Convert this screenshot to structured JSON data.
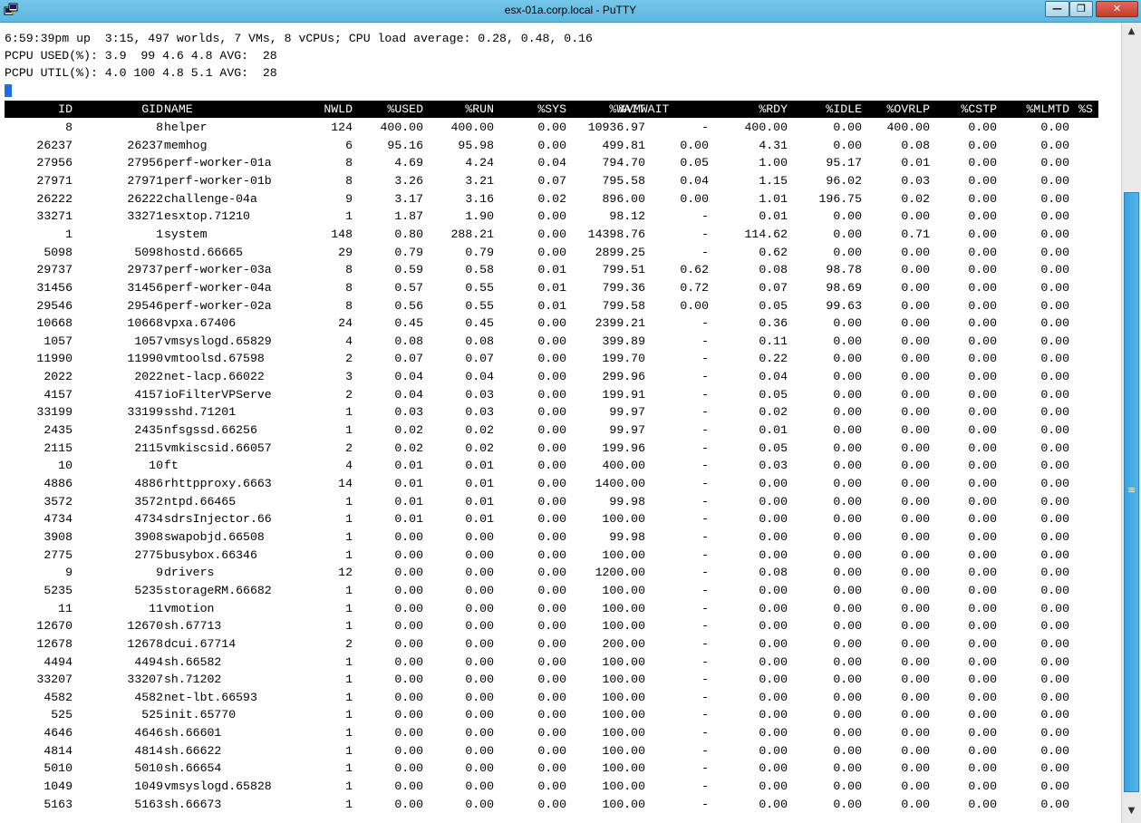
{
  "window": {
    "title": "esx-01a.corp.local - PuTTY",
    "icon": "putty-terminal-icon",
    "buttons": {
      "minimize": "—",
      "maximize": "❐",
      "close": "✕"
    }
  },
  "summary": {
    "uptime_line": "6:59:39pm up  3:15, 497 worlds, 7 VMs, 8 vCPUs; CPU load average: 0.28, 0.48, 0.16",
    "pcpu_used_line": "PCPU USED(%): 3.9  99 4.6 4.8 AVG:  28",
    "pcpu_util_line": "PCPU UTIL(%): 4.0 100 4.8 5.1 AVG:  28"
  },
  "table": {
    "headers": [
      "ID",
      "GID",
      "NAME",
      "NWLD",
      "%USED",
      "%RUN",
      "%SYS",
      "%WAIT",
      "%VMWAIT",
      "%RDY",
      "%IDLE",
      "%OVRLP",
      "%CSTP",
      "%MLMTD",
      "%S"
    ],
    "rows": [
      [
        "8",
        "8",
        "helper",
        "124",
        "400.00",
        "400.00",
        "0.00",
        "10936.97",
        "-",
        "400.00",
        "0.00",
        "400.00",
        "0.00",
        "0.00"
      ],
      [
        "26237",
        "26237",
        "memhog",
        "6",
        "95.16",
        "95.98",
        "0.00",
        "499.81",
        "0.00",
        "4.31",
        "0.00",
        "0.08",
        "0.00",
        "0.00"
      ],
      [
        "27956",
        "27956",
        "perf-worker-01a",
        "8",
        "4.69",
        "4.24",
        "0.04",
        "794.70",
        "0.05",
        "1.00",
        "95.17",
        "0.01",
        "0.00",
        "0.00"
      ],
      [
        "27971",
        "27971",
        "perf-worker-01b",
        "8",
        "3.26",
        "3.21",
        "0.07",
        "795.58",
        "0.04",
        "1.15",
        "96.02",
        "0.03",
        "0.00",
        "0.00"
      ],
      [
        "26222",
        "26222",
        "challenge-04a",
        "9",
        "3.17",
        "3.16",
        "0.02",
        "896.00",
        "0.00",
        "1.01",
        "196.75",
        "0.02",
        "0.00",
        "0.00"
      ],
      [
        "33271",
        "33271",
        "esxtop.71210",
        "1",
        "1.87",
        "1.90",
        "0.00",
        "98.12",
        "-",
        "0.01",
        "0.00",
        "0.00",
        "0.00",
        "0.00"
      ],
      [
        "1",
        "1",
        "system",
        "148",
        "0.80",
        "288.21",
        "0.00",
        "14398.76",
        "-",
        "114.62",
        "0.00",
        "0.71",
        "0.00",
        "0.00"
      ],
      [
        "5098",
        "5098",
        "hostd.66665",
        "29",
        "0.79",
        "0.79",
        "0.00",
        "2899.25",
        "-",
        "0.62",
        "0.00",
        "0.00",
        "0.00",
        "0.00"
      ],
      [
        "29737",
        "29737",
        "perf-worker-03a",
        "8",
        "0.59",
        "0.58",
        "0.01",
        "799.51",
        "0.62",
        "0.08",
        "98.78",
        "0.00",
        "0.00",
        "0.00"
      ],
      [
        "31456",
        "31456",
        "perf-worker-04a",
        "8",
        "0.57",
        "0.55",
        "0.01",
        "799.36",
        "0.72",
        "0.07",
        "98.69",
        "0.00",
        "0.00",
        "0.00"
      ],
      [
        "29546",
        "29546",
        "perf-worker-02a",
        "8",
        "0.56",
        "0.55",
        "0.01",
        "799.58",
        "0.00",
        "0.05",
        "99.63",
        "0.00",
        "0.00",
        "0.00"
      ],
      [
        "10668",
        "10668",
        "vpxa.67406",
        "24",
        "0.45",
        "0.45",
        "0.00",
        "2399.21",
        "-",
        "0.36",
        "0.00",
        "0.00",
        "0.00",
        "0.00"
      ],
      [
        "1057",
        "1057",
        "vmsyslogd.65829",
        "4",
        "0.08",
        "0.08",
        "0.00",
        "399.89",
        "-",
        "0.11",
        "0.00",
        "0.00",
        "0.00",
        "0.00"
      ],
      [
        "11990",
        "11990",
        "vmtoolsd.67598",
        "2",
        "0.07",
        "0.07",
        "0.00",
        "199.70",
        "-",
        "0.22",
        "0.00",
        "0.00",
        "0.00",
        "0.00"
      ],
      [
        "2022",
        "2022",
        "net-lacp.66022",
        "3",
        "0.04",
        "0.04",
        "0.00",
        "299.96",
        "-",
        "0.04",
        "0.00",
        "0.00",
        "0.00",
        "0.00"
      ],
      [
        "4157",
        "4157",
        "ioFilterVPServe",
        "2",
        "0.04",
        "0.03",
        "0.00",
        "199.91",
        "-",
        "0.05",
        "0.00",
        "0.00",
        "0.00",
        "0.00"
      ],
      [
        "33199",
        "33199",
        "sshd.71201",
        "1",
        "0.03",
        "0.03",
        "0.00",
        "99.97",
        "-",
        "0.02",
        "0.00",
        "0.00",
        "0.00",
        "0.00"
      ],
      [
        "2435",
        "2435",
        "nfsgssd.66256",
        "1",
        "0.02",
        "0.02",
        "0.00",
        "99.97",
        "-",
        "0.01",
        "0.00",
        "0.00",
        "0.00",
        "0.00"
      ],
      [
        "2115",
        "2115",
        "vmkiscsid.66057",
        "2",
        "0.02",
        "0.02",
        "0.00",
        "199.96",
        "-",
        "0.05",
        "0.00",
        "0.00",
        "0.00",
        "0.00"
      ],
      [
        "10",
        "10",
        "ft",
        "4",
        "0.01",
        "0.01",
        "0.00",
        "400.00",
        "-",
        "0.03",
        "0.00",
        "0.00",
        "0.00",
        "0.00"
      ],
      [
        "4886",
        "4886",
        "rhttpproxy.6663",
        "14",
        "0.01",
        "0.01",
        "0.00",
        "1400.00",
        "-",
        "0.00",
        "0.00",
        "0.00",
        "0.00",
        "0.00"
      ],
      [
        "3572",
        "3572",
        "ntpd.66465",
        "1",
        "0.01",
        "0.01",
        "0.00",
        "99.98",
        "-",
        "0.00",
        "0.00",
        "0.00",
        "0.00",
        "0.00"
      ],
      [
        "4734",
        "4734",
        "sdrsInjector.66",
        "1",
        "0.01",
        "0.01",
        "0.00",
        "100.00",
        "-",
        "0.00",
        "0.00",
        "0.00",
        "0.00",
        "0.00"
      ],
      [
        "3908",
        "3908",
        "swapobjd.66508",
        "1",
        "0.00",
        "0.00",
        "0.00",
        "99.98",
        "-",
        "0.00",
        "0.00",
        "0.00",
        "0.00",
        "0.00"
      ],
      [
        "2775",
        "2775",
        "busybox.66346",
        "1",
        "0.00",
        "0.00",
        "0.00",
        "100.00",
        "-",
        "0.00",
        "0.00",
        "0.00",
        "0.00",
        "0.00"
      ],
      [
        "9",
        "9",
        "drivers",
        "12",
        "0.00",
        "0.00",
        "0.00",
        "1200.00",
        "-",
        "0.08",
        "0.00",
        "0.00",
        "0.00",
        "0.00"
      ],
      [
        "5235",
        "5235",
        "storageRM.66682",
        "1",
        "0.00",
        "0.00",
        "0.00",
        "100.00",
        "-",
        "0.00",
        "0.00",
        "0.00",
        "0.00",
        "0.00"
      ],
      [
        "11",
        "11",
        "vmotion",
        "1",
        "0.00",
        "0.00",
        "0.00",
        "100.00",
        "-",
        "0.00",
        "0.00",
        "0.00",
        "0.00",
        "0.00"
      ],
      [
        "12670",
        "12670",
        "sh.67713",
        "1",
        "0.00",
        "0.00",
        "0.00",
        "100.00",
        "-",
        "0.00",
        "0.00",
        "0.00",
        "0.00",
        "0.00"
      ],
      [
        "12678",
        "12678",
        "dcui.67714",
        "2",
        "0.00",
        "0.00",
        "0.00",
        "200.00",
        "-",
        "0.00",
        "0.00",
        "0.00",
        "0.00",
        "0.00"
      ],
      [
        "4494",
        "4494",
        "sh.66582",
        "1",
        "0.00",
        "0.00",
        "0.00",
        "100.00",
        "-",
        "0.00",
        "0.00",
        "0.00",
        "0.00",
        "0.00"
      ],
      [
        "33207",
        "33207",
        "sh.71202",
        "1",
        "0.00",
        "0.00",
        "0.00",
        "100.00",
        "-",
        "0.00",
        "0.00",
        "0.00",
        "0.00",
        "0.00"
      ],
      [
        "4582",
        "4582",
        "net-lbt.66593",
        "1",
        "0.00",
        "0.00",
        "0.00",
        "100.00",
        "-",
        "0.00",
        "0.00",
        "0.00",
        "0.00",
        "0.00"
      ],
      [
        "525",
        "525",
        "init.65770",
        "1",
        "0.00",
        "0.00",
        "0.00",
        "100.00",
        "-",
        "0.00",
        "0.00",
        "0.00",
        "0.00",
        "0.00"
      ],
      [
        "4646",
        "4646",
        "sh.66601",
        "1",
        "0.00",
        "0.00",
        "0.00",
        "100.00",
        "-",
        "0.00",
        "0.00",
        "0.00",
        "0.00",
        "0.00"
      ],
      [
        "4814",
        "4814",
        "sh.66622",
        "1",
        "0.00",
        "0.00",
        "0.00",
        "100.00",
        "-",
        "0.00",
        "0.00",
        "0.00",
        "0.00",
        "0.00"
      ],
      [
        "5010",
        "5010",
        "sh.66654",
        "1",
        "0.00",
        "0.00",
        "0.00",
        "100.00",
        "-",
        "0.00",
        "0.00",
        "0.00",
        "0.00",
        "0.00"
      ],
      [
        "1049",
        "1049",
        "vmsyslogd.65828",
        "1",
        "0.00",
        "0.00",
        "0.00",
        "100.00",
        "-",
        "0.00",
        "0.00",
        "0.00",
        "0.00",
        "0.00"
      ],
      [
        "5163",
        "5163",
        "sh.66673",
        "1",
        "0.00",
        "0.00",
        "0.00",
        "100.00",
        "-",
        "0.00",
        "0.00",
        "0.00",
        "0.00",
        "0.00"
      ]
    ]
  },
  "scrollbar": {
    "up_arrow": "▲",
    "down_arrow": "▼",
    "grip": "≡"
  },
  "colors": {
    "titlebar": "#6cc0e6",
    "header_bg": "#000000",
    "header_fg": "#ffffff",
    "cursor": "#1e6fe6",
    "thumb": "#3aa3e0"
  }
}
